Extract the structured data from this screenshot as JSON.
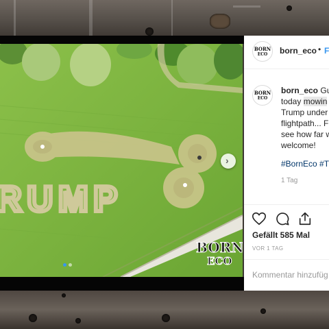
{
  "post": {
    "avatar_line1": "BORN",
    "avatar_line2": "ECO",
    "username": "born_eco",
    "follow_label": "F",
    "caption_user": "born_eco",
    "caption_lines": [
      "Gu",
      "today ",
      "mowin",
      "Trump under",
      "flightpath... F",
      "see how far w",
      "welcome!"
    ],
    "hashtag": "#BornEco #T",
    "age": "1 Tag",
    "likes": "Gefällt 585 Mal",
    "ago": "VOR 1 TAG",
    "comment_placeholder": "Kommentar hinzufüg"
  },
  "photo": {
    "field_text": "RUMP",
    "watermark_line1": "BORN",
    "watermark_line2": "ECO",
    "slide_count": 2,
    "active_slide": 1
  },
  "icons": {
    "like": "heart-icon",
    "comment": "comment-icon",
    "share": "share-icon",
    "next": "chevron-right-icon"
  },
  "colors": {
    "link": "#3897f0",
    "hashtag": "#003569",
    "grass": "#7db53d",
    "mowed": "#c9c48a"
  }
}
